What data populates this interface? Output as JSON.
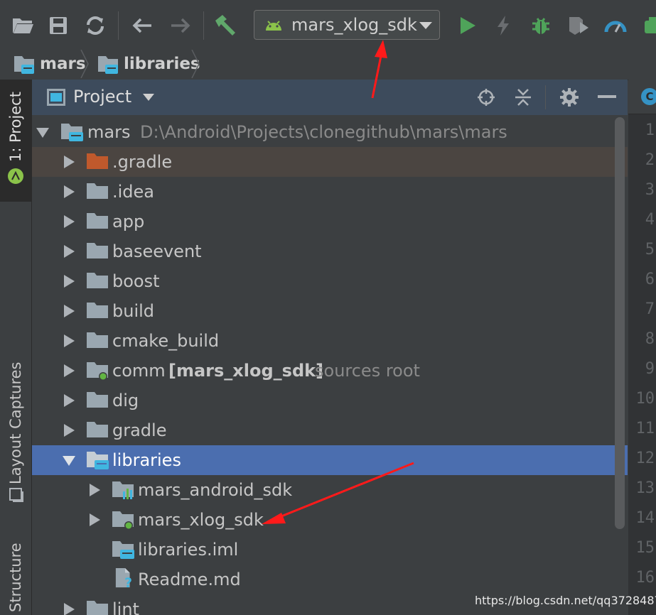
{
  "toolbar": {
    "icons": [
      "open-folder-icon",
      "save-icon",
      "sync-icon",
      "back-icon",
      "forward-icon",
      "make-project-icon",
      "run-icon",
      "apply-changes-icon",
      "debug-icon",
      "run-with-coverage-icon",
      "profile-icon",
      "sdk-manager-icon"
    ],
    "run_config": "mars_xlog_sdk",
    "colors": {
      "run": "#4fa35a",
      "android": "#8bc34a",
      "hammer": "#60a86b",
      "profile": "#3592c4",
      "accent": "#ff0000"
    }
  },
  "breadcrumb": {
    "items": [
      "mars",
      "libraries"
    ]
  },
  "toolstrip": {
    "project": "1: Project",
    "layout_captures": "Layout Captures",
    "structure": "Structure"
  },
  "project_panel": {
    "title": "Project",
    "header_icons": [
      "locate-icon",
      "collapse-all-icon",
      "settings-icon",
      "hide-icon"
    ]
  },
  "tree": {
    "root": {
      "name": "mars",
      "path": "D:\\Android\\Projects\\clonegithub\\mars\\mars"
    },
    "items": [
      {
        "name": ".gradle",
        "type": "excluded-folder",
        "expanded": false
      },
      {
        "name": ".idea",
        "type": "folder",
        "expanded": false
      },
      {
        "name": "app",
        "type": "folder",
        "expanded": false
      },
      {
        "name": "baseevent",
        "type": "folder",
        "expanded": false
      },
      {
        "name": "boost",
        "type": "folder",
        "expanded": false
      },
      {
        "name": "build",
        "type": "folder",
        "expanded": false
      },
      {
        "name": "cmake_build",
        "type": "folder",
        "expanded": false
      },
      {
        "name": "comm",
        "module": "[mars_xlog_sdk]",
        "extra": "sources root",
        "type": "module-folder",
        "expanded": false
      },
      {
        "name": "dig",
        "type": "folder",
        "expanded": false
      },
      {
        "name": "gradle",
        "type": "folder",
        "expanded": false
      },
      {
        "name": "libraries",
        "type": "module-folder",
        "expanded": true,
        "selected": true
      },
      {
        "name": "mars_android_sdk",
        "type": "android-module",
        "expanded": false
      },
      {
        "name": "mars_xlog_sdk",
        "type": "module-folder",
        "expanded": false
      },
      {
        "name": "libraries.iml",
        "type": "iml-file"
      },
      {
        "name": "Readme.md",
        "type": "unknown-file"
      },
      {
        "name": "lint",
        "type": "folder",
        "expanded": false
      }
    ]
  },
  "editor": {
    "tab_letter": "C",
    "line_numbers": [
      "1",
      "2",
      "3",
      "4",
      "5",
      "6",
      "7",
      "8",
      "9",
      "10",
      "11",
      "12",
      "13",
      "14",
      "15",
      "16"
    ]
  },
  "watermark": "https://blog.csdn.net/qq372848728"
}
